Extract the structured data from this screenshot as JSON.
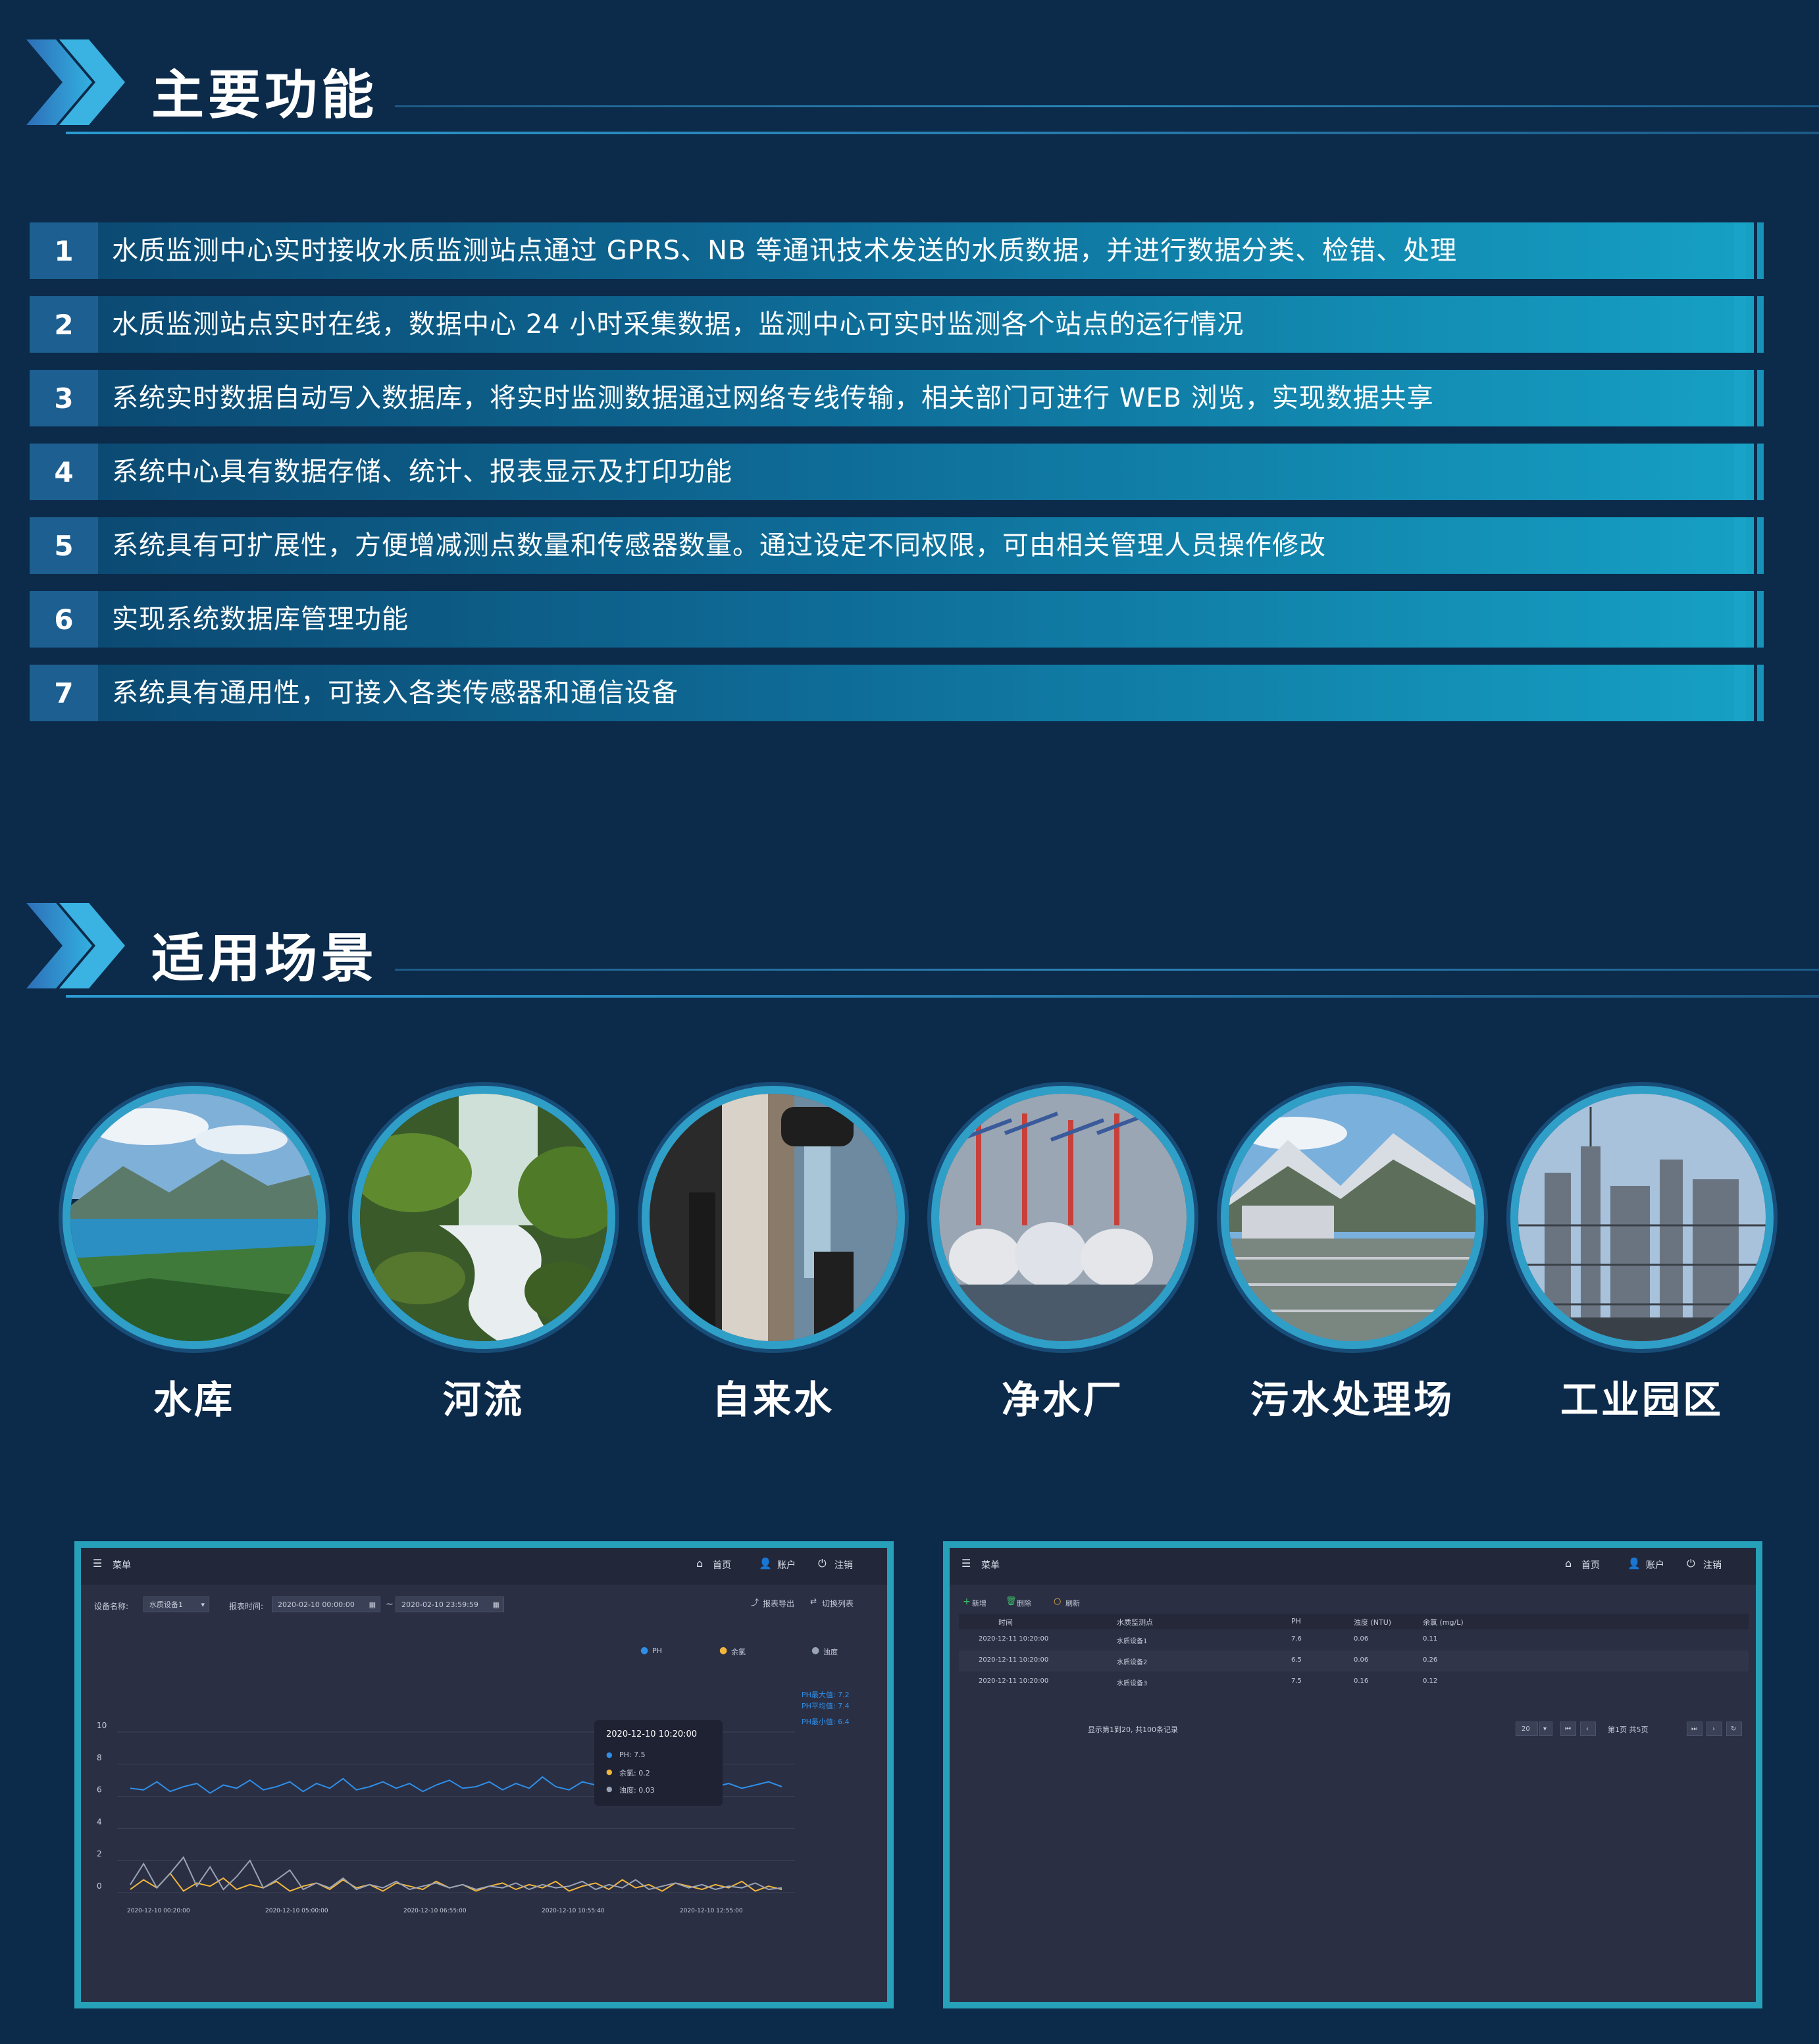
{
  "sections": {
    "features_title": "主要功能",
    "scenes_title": "适用场景"
  },
  "features": [
    {
      "num": "1",
      "text": "水质监测中心实时接收水质监测站点通过 GPRS、NB 等通讯技术发送的水质数据，并进行数据分类、检错、处理"
    },
    {
      "num": "2",
      "text": "水质监测站点实时在线，数据中心 24 小时采集数据，监测中心可实时监测各个站点的运行情况"
    },
    {
      "num": "3",
      "text": "系统实时数据自动写入数据库，将实时监测数据通过网络专线传输，相关部门可进行 WEB 浏览，实现数据共享"
    },
    {
      "num": "4",
      "text": "系统中心具有数据存储、统计、报表显示及打印功能"
    },
    {
      "num": "5",
      "text": "系统具有可扩展性，方便增减测点数量和传感器数量。通过设定不同权限，可由相关管理人员操作修改"
    },
    {
      "num": "6",
      "text": "实现系统数据库管理功能"
    },
    {
      "num": "7",
      "text": "系统具有通用性，可接入各类传感器和通信设备"
    }
  ],
  "scenes": [
    "水库",
    "河流",
    "自来水",
    "净水厂",
    "污水处理场",
    "工业园区"
  ],
  "left_screen": {
    "menu_label": "菜单",
    "nav_home": "首页",
    "nav_user": "账户",
    "nav_logout": "注销",
    "device_label": "设备名称:",
    "device_value": "水质设备1",
    "time_label": "报表时间:",
    "time_start": "2020-02-10 00:00:00",
    "time_sep": "~",
    "time_end": "2020-02-10 23:59:59",
    "export_label": "报表导出",
    "switch_label": "切换列表",
    "legend": [
      "PH",
      "余氯",
      "浊度"
    ],
    "tooltip": {
      "time": "2020-12-10 10:20:00",
      "ph": "PH: 7.5",
      "cl": "余氯: 0.2",
      "turb": "浊度: 0.03"
    },
    "stats": [
      "PH最大值: 7.2",
      "PH平均值: 7.4",
      "PH最小值: 6.4"
    ]
  },
  "chart_data": {
    "type": "line",
    "yticks": [
      0,
      2,
      4,
      6,
      8,
      10
    ],
    "ylim": [
      0,
      10
    ],
    "xticks": [
      "2020-12-10 00:20:00",
      "2020-12-10 05:00:00",
      "2020-12-10 06:55:00",
      "2020-12-10 10:55:40",
      "2020-12-10 12:55:00"
    ],
    "series": [
      {
        "name": "PH",
        "color": "#2f8fe8",
        "values": [
          6.5,
          6.4,
          6.9,
          6.3,
          6.6,
          6.8,
          6.2,
          6.7,
          6.5,
          7.0,
          6.4,
          6.6,
          6.9,
          6.3,
          6.8,
          6.5,
          7.1,
          6.4,
          6.6,
          6.9,
          6.5,
          6.8,
          6.3,
          6.7,
          7.0,
          6.5,
          6.6,
          6.9,
          6.4,
          6.8,
          6.5,
          7.2,
          6.6,
          6.4,
          6.9,
          6.7,
          6.5,
          6.8,
          6.6,
          7.0,
          6.4,
          6.7,
          6.9,
          6.5,
          6.6,
          6.8,
          6.5,
          6.7,
          6.9,
          6.6
        ]
      },
      {
        "name": "余氯",
        "color": "#f2b63c",
        "values": [
          0.2,
          0.8,
          0.3,
          1.2,
          0.1,
          0.6,
          0.4,
          0.9,
          0.2,
          0.5,
          0.3,
          0.7,
          0.1,
          0.4,
          0.6,
          0.2,
          0.8,
          0.3,
          0.5,
          0.1,
          0.6,
          0.4,
          0.2,
          0.7,
          0.3,
          0.5,
          0.1,
          0.4,
          0.6,
          0.2,
          0.5,
          0.3,
          0.7,
          0.1,
          0.4,
          0.6,
          0.2,
          0.8,
          0.3,
          0.5,
          0.1,
          0.6,
          0.4,
          0.2,
          0.5,
          0.3,
          0.7,
          0.1,
          0.4,
          0.2
        ]
      },
      {
        "name": "浊度",
        "color": "#9aa3b5",
        "values": [
          0.5,
          1.8,
          0.3,
          1.2,
          2.2,
          0.4,
          1.6,
          0.2,
          1.0,
          2.0,
          0.3,
          0.8,
          1.4,
          0.2,
          0.6,
          0.3,
          0.9,
          0.2,
          0.5,
          0.3,
          0.7,
          0.2,
          0.4,
          0.6,
          0.3,
          0.5,
          0.2,
          0.4,
          0.3,
          0.6,
          0.2,
          0.5,
          0.3,
          0.4,
          0.7,
          0.2,
          0.5,
          0.3,
          0.8,
          0.2,
          0.4,
          0.6,
          0.3,
          0.5,
          0.2,
          0.4,
          0.3,
          0.6,
          0.2,
          0.3
        ]
      }
    ]
  },
  "right_screen": {
    "menu_label": "菜单",
    "nav_home": "首页",
    "nav_user": "账户",
    "nav_logout": "注销",
    "btn_add": "新增",
    "btn_delete": "删除",
    "btn_refresh": "刷新",
    "columns": [
      "时间",
      "水质监测点",
      "PH",
      "浊度 (NTU)",
      "余氯 (mg/L)"
    ],
    "rows": [
      [
        "2020-12-11 10:20:00",
        "水质设备1",
        "7.6",
        "0.06",
        "0.11"
      ],
      [
        "2020-12-11 10:20:00",
        "水质设备2",
        "6.5",
        "0.06",
        "0.26"
      ],
      [
        "2020-12-11 10:20:00",
        "水质设备3",
        "7.5",
        "0.16",
        "0.12"
      ]
    ],
    "footer_info": "显示第1到20, 共100条记录",
    "page_size": "20",
    "page_info": "第1页 共5页"
  },
  "colors": {
    "background": "#0c2a4a",
    "accent": "#2f9fc8",
    "screen_bg": "#2a2f44"
  }
}
